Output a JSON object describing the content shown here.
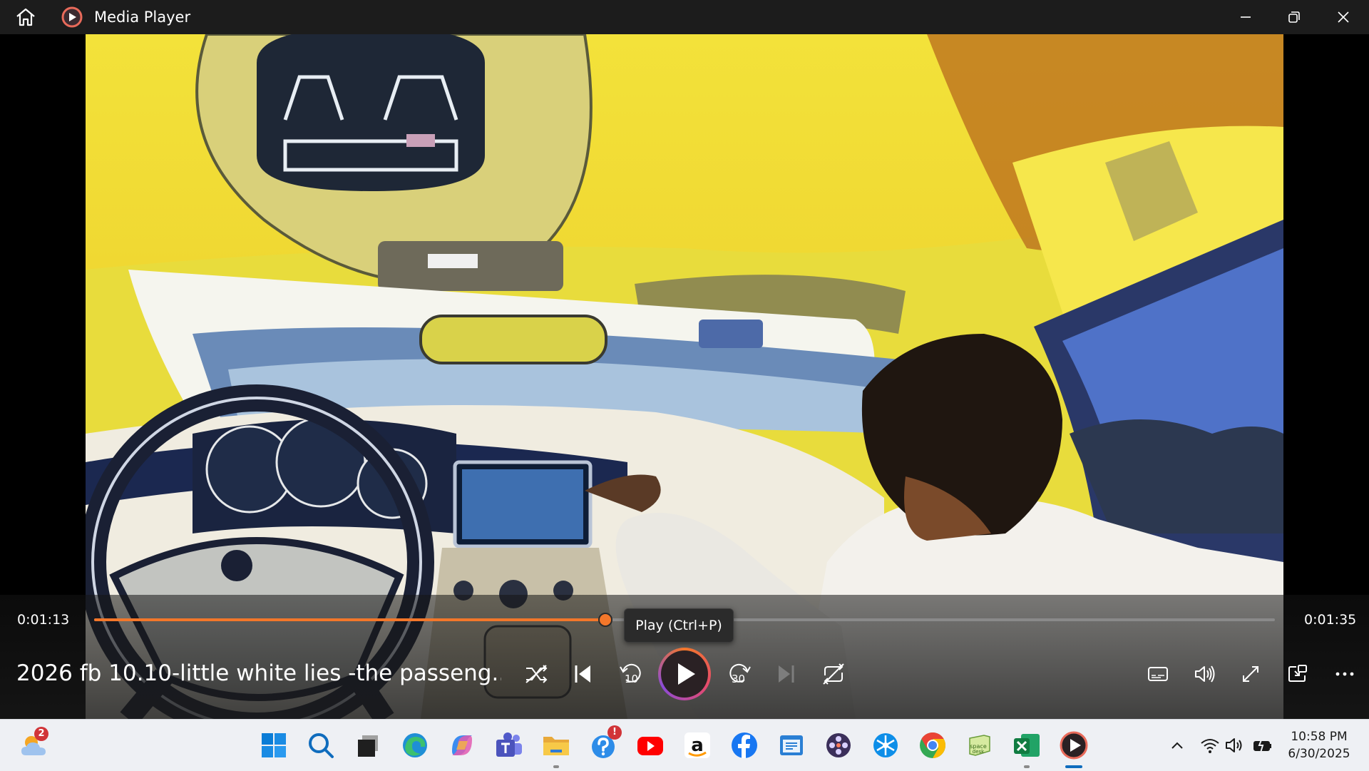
{
  "window": {
    "title": "Media Player",
    "buttons": {
      "minimize": "minimize",
      "maximize": "restore",
      "close": "close"
    }
  },
  "player": {
    "current_time": "0:01:13",
    "duration": "0:01:35",
    "progress": 0.433,
    "media_title": "2026 fb 10.10-little white lies -the passeng...",
    "tooltip": "Play (Ctrl+P)",
    "accent_color": "#f3772a"
  },
  "controls": {
    "left": [
      "shuffle-icon",
      "previous-icon",
      "skip-back-10-icon",
      "play-icon",
      "skip-forward-30-icon",
      "next-icon",
      "repeat-icon"
    ],
    "right": [
      "captions-icon",
      "volume-icon",
      "fullscreen-icon",
      "miniplayer-icon",
      "more-icon"
    ],
    "skip_back_label": "10",
    "skip_forward_label": "30"
  },
  "taskbar": {
    "weather_badge": "2",
    "store_badge": "!",
    "apps": [
      "start",
      "search",
      "task-view",
      "edge",
      "copilot",
      "teams",
      "file-explorer",
      "help",
      "youtube",
      "amazon",
      "facebook",
      "remote-desktop",
      "clipchamp",
      "snip",
      "chrome",
      "spacedesk",
      "excel",
      "media-player"
    ],
    "clock_time": "10:58 PM",
    "clock_date": "6/30/2025"
  }
}
